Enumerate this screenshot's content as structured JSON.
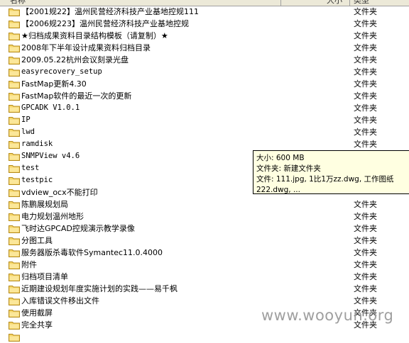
{
  "header": {
    "name_label": "名称",
    "size_label": "大小",
    "type_label": "类型"
  },
  "rows": [
    {
      "name": "【2001规22】温州民营经济科技产业基地控规111",
      "type": "文件夹"
    },
    {
      "name": "【2006规223】温州民营经济科技产业基地控规",
      "type": "文件夹"
    },
    {
      "name": "★归档成果资料目录结构模板（请复制）★",
      "type": "文件夹"
    },
    {
      "name": "2008年下半年设计成果资料归档目录",
      "type": "文件夹"
    },
    {
      "name": "2009.05.22杭州会议刻录光盘",
      "type": "文件夹"
    },
    {
      "name": "easyrecovery_setup",
      "type": "文件夹"
    },
    {
      "name": "FastMap更新4.30",
      "type": "文件夹"
    },
    {
      "name": "FastMap软件的最近一次的更新",
      "type": "文件夹"
    },
    {
      "name": "GPCADK V1.0.1",
      "type": "文件夹"
    },
    {
      "name": "IP",
      "type": "文件夹"
    },
    {
      "name": "lwd",
      "type": "文件夹"
    },
    {
      "name": "ramdisk",
      "type": "文件夹"
    },
    {
      "name": "SNMPView v4.6",
      "type": ""
    },
    {
      "name": "test",
      "type": ""
    },
    {
      "name": "testpic",
      "type": ""
    },
    {
      "name": "vdview_ocx不能打印",
      "type": ""
    },
    {
      "name": "陈鹏展规划局",
      "type": "文件夹"
    },
    {
      "name": "电力规划温州地形",
      "type": "文件夹"
    },
    {
      "name": "飞时达GPCAD控规演示教学录像",
      "type": "文件夹"
    },
    {
      "name": "分图工具",
      "type": "文件夹"
    },
    {
      "name": "服务器版杀毒软件Symantec11.0.4000",
      "type": "文件夹"
    },
    {
      "name": "附件",
      "type": "文件夹"
    },
    {
      "name": "归档项目清单",
      "type": "文件夹"
    },
    {
      "name": "近期建设规划年度实施计划的实践——易千枫",
      "type": "文件夹"
    },
    {
      "name": "入库错误文件移出文件",
      "type": "文件夹"
    },
    {
      "name": "使用截屏",
      "type": "文件夹"
    },
    {
      "name": "完全共享",
      "type": "文件夹"
    },
    {
      "name": "",
      "type": ""
    }
  ],
  "tooltip": {
    "line1": "大小: 600 MB",
    "line2": "文件夹: 新建文件夹",
    "line3": "文件: 111.jpg, 1比1万zz.dwg, 工作图纸",
    "line4": "222.dwg, ..."
  },
  "watermark": "www.wooyun.org",
  "colors": {
    "folder_fill": "#f5d66a",
    "folder_stroke": "#b58a1a",
    "tooltip_bg": "#ffffe1"
  }
}
